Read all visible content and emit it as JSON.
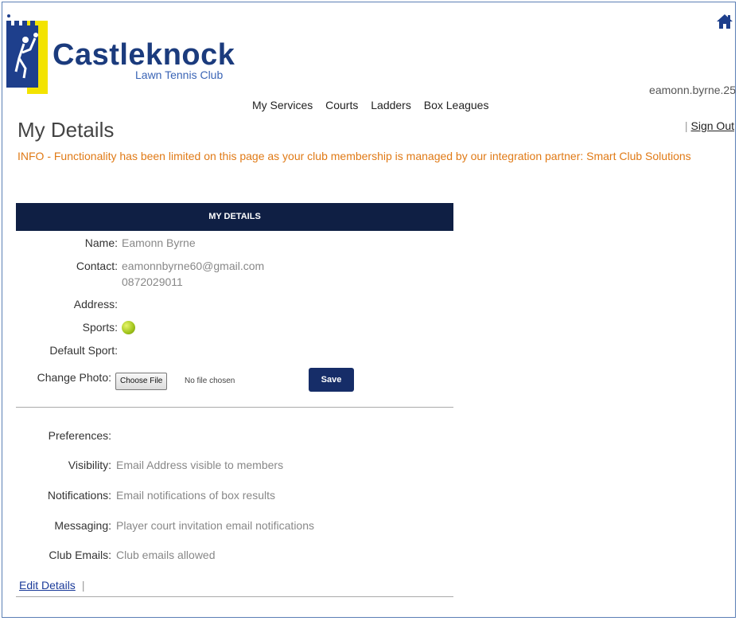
{
  "header": {
    "brand_name": "Castleknock",
    "brand_sub": "Lawn Tennis Club",
    "username": "eamonn.byrne.25",
    "home_icon": "home-icon",
    "nav": [
      "My Services",
      "Courts",
      "Ladders",
      "Box Leagues"
    ],
    "sign_out": "Sign Out"
  },
  "page": {
    "title": "My Details",
    "info": "INFO - Functionality has been limited on this page as your club membership is managed by our integration partner: Smart Club Solutions"
  },
  "details": {
    "heading": "MY DETAILS",
    "name_label": "Name:",
    "name_value": "Eamonn Byrne",
    "contact_label": "Contact:",
    "contact_email": "eamonnbyrne60@gmail.com",
    "contact_phone": "0872029011",
    "address_label": "Address:",
    "sports_label": "Sports:",
    "sports_icon": "tennis-ball-icon",
    "default_sport_label": "Default Sport:",
    "change_photo_label": "Change Photo:",
    "choose_file": "Choose File",
    "file_status": "No file chosen",
    "save": "Save"
  },
  "preferences": {
    "heading": "Preferences:",
    "visibility_label": "Visibility:",
    "visibility_value": "Email Address visible to members",
    "notifications_label": "Notifications:",
    "notifications_value": "Email notifications of box results",
    "messaging_label": "Messaging:",
    "messaging_value": "Player court invitation email notifications",
    "club_emails_label": "Club Emails:",
    "club_emails_value": "Club emails allowed"
  },
  "footer": {
    "edit_details": "Edit Details"
  },
  "colors": {
    "brand_blue": "#1b3b7d",
    "header_bar": "#0f1f44",
    "info_orange": "#e07a16",
    "save_button": "#162d68"
  }
}
